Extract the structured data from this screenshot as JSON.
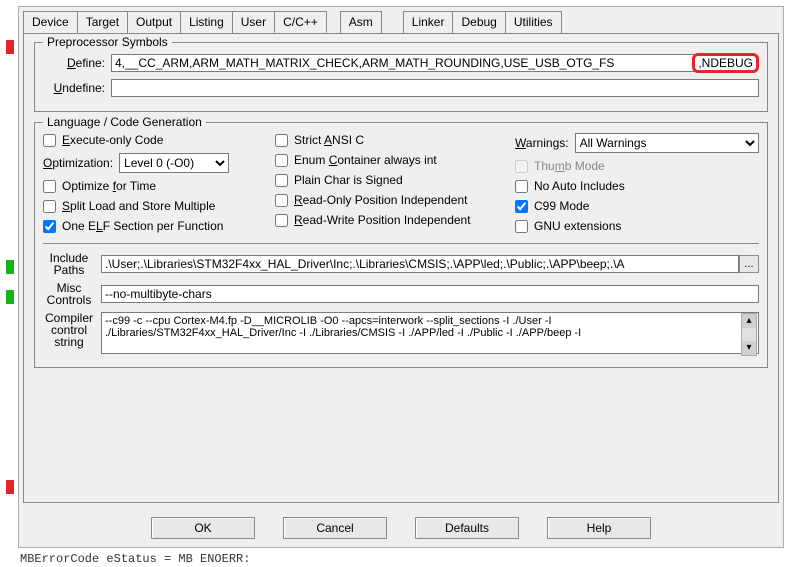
{
  "tabs": [
    "Device",
    "Target",
    "Output",
    "Listing",
    "User",
    "C/C++",
    "Asm",
    "Linker",
    "Debug",
    "Utilities"
  ],
  "activeTab": 5,
  "preprocessor": {
    "legend": "Preprocessor Symbols",
    "defineLabel": "Define:",
    "defineValue": "4,__CC_ARM,ARM_MATH_MATRIX_CHECK,ARM_MATH_ROUNDING,USE_USB_OTG_FS",
    "defineHighlight": ",NDEBUG",
    "undefineLabel": "Undefine:",
    "undefineValue": ""
  },
  "lang": {
    "legend": "Language / Code Generation",
    "execOnly": "Execute-only Code",
    "optimizationLabel": "Optimization:",
    "optimizationValue": "Level 0 (-O0)",
    "optimizeTime": "Optimize for Time",
    "splitLoad": "Split Load and Store Multiple",
    "oneElf": "One ELF Section per Function",
    "strictAnsi": "Strict ANSI C",
    "enumContainer": "Enum Container always int",
    "plainChar": "Plain Char is Signed",
    "readOnly": "Read-Only Position Independent",
    "readWrite": "Read-Write Position Independent",
    "warningsLabel": "Warnings:",
    "warningsValue": "All Warnings",
    "thumbMode": "Thumb Mode",
    "noAutoInc": "No Auto Includes",
    "c99": "C99 Mode",
    "gnuExt": "GNU extensions",
    "includePathsLabel": "Include\nPaths",
    "includePathsValue": ".\\User;.\\Libraries\\STM32F4xx_HAL_Driver\\Inc;.\\Libraries\\CMSIS;.\\APP\\led;.\\Public;.\\APP\\beep;.\\A",
    "miscLabel": "Misc\nControls",
    "miscValue": "--no-multibyte-chars",
    "compilerLabel": "Compiler\ncontrol\nstring",
    "compilerValue": "--c99 -c --cpu Cortex-M4.fp -D__MICROLIB -O0 --apcs=interwork --split_sections -I ./User -I ./Libraries/STM32F4xx_HAL_Driver/Inc -I ./Libraries/CMSIS -I ./APP/led -I ./Public -I ./APP/beep -I"
  },
  "buttons": {
    "ok": "OK",
    "cancel": "Cancel",
    "defaults": "Defaults",
    "help": "Help"
  },
  "codeBehind": "MBErrorCode    eStatus = MB ENOERR:"
}
